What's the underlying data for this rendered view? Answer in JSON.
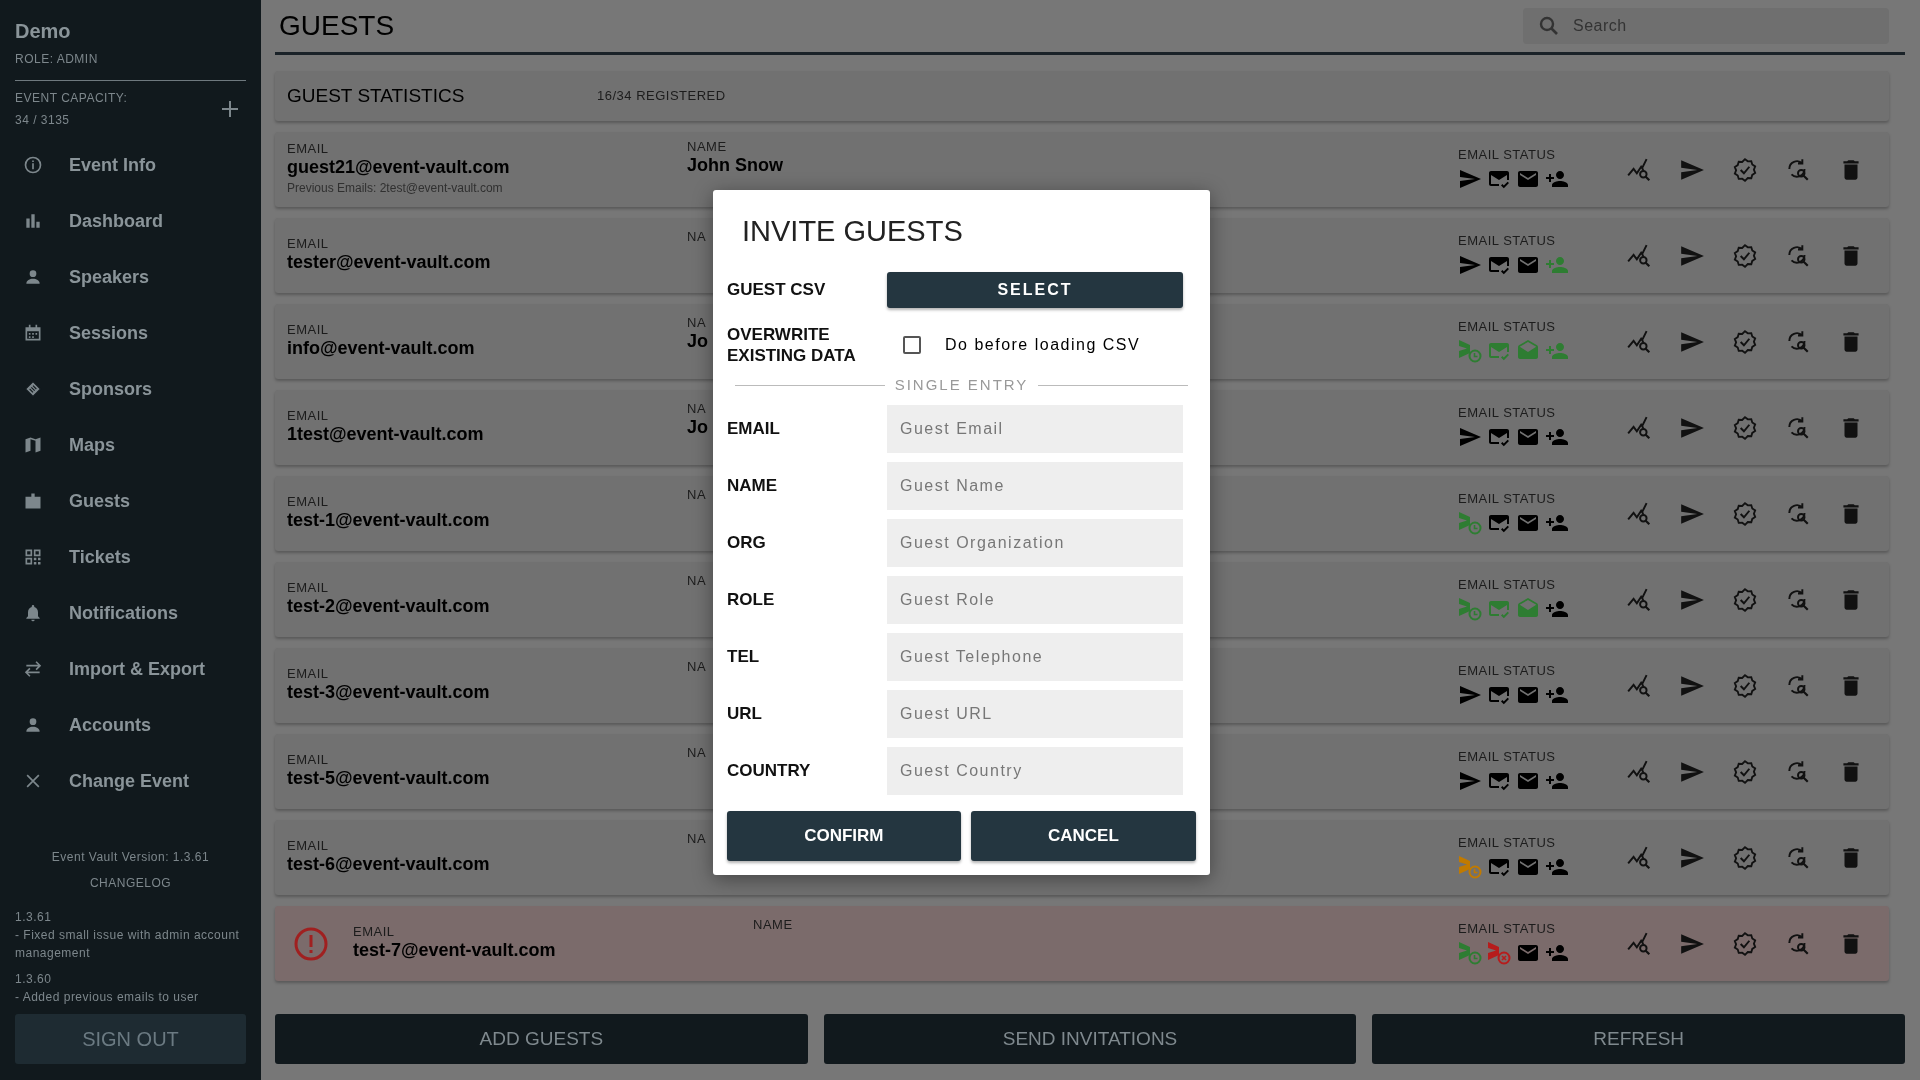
{
  "sidebar": {
    "title": "Demo",
    "role": "ROLE: ADMIN",
    "capacity_label": "EVENT CAPACITY:",
    "capacity": "34 / 3135",
    "items": [
      {
        "label": "Event Info"
      },
      {
        "label": "Dashboard"
      },
      {
        "label": "Speakers"
      },
      {
        "label": "Sessions"
      },
      {
        "label": "Sponsors"
      },
      {
        "label": "Maps"
      },
      {
        "label": "Guests"
      },
      {
        "label": "Tickets"
      },
      {
        "label": "Notifications"
      },
      {
        "label": "Import & Export"
      },
      {
        "label": "Accounts"
      },
      {
        "label": "Change Event"
      }
    ],
    "version": "Event Vault Version: 1.3.61",
    "changelog_link": "CHANGELOG",
    "changelog": [
      {
        "version": "1.3.61",
        "note": "- Fixed small issue with admin account management"
      },
      {
        "version": "1.3.60",
        "note": "- Added previous emails to user"
      }
    ],
    "sign_out": "SIGN OUT"
  },
  "header": {
    "title": "GUESTS",
    "search": {
      "placeholder": "Search"
    }
  },
  "statistics": {
    "title": "GUEST STATISTICS",
    "registered": "16/34 REGISTERED"
  },
  "guests": [
    {
      "email_label": "EMAIL",
      "email": "guest21@event-vault.com",
      "previous": "Previous Emails: 2test@event-vault.com",
      "name_label": "NAME",
      "name": "John Snow",
      "status_label": "EMAIL STATUS",
      "error": false,
      "status": [
        {
          "kind": "sent",
          "color": "#000000"
        },
        {
          "kind": "delivered",
          "color": "#000000"
        },
        {
          "kind": "mail",
          "color": "#000000"
        },
        {
          "kind": "registered",
          "color": "#000000"
        }
      ]
    },
    {
      "email_label": "EMAIL",
      "email": "tester@event-vault.com",
      "name_label": "NA",
      "status_label": "EMAIL STATUS",
      "error": false,
      "status": [
        {
          "kind": "sent",
          "color": "#000000"
        },
        {
          "kind": "delivered",
          "color": "#000000"
        },
        {
          "kind": "mail",
          "color": "#000000"
        },
        {
          "kind": "registered",
          "color": "#2e7d32"
        }
      ]
    },
    {
      "email_label": "EMAIL",
      "email": "info@event-vault.com",
      "name_label": "NA",
      "name": "Jo",
      "status_label": "EMAIL STATUS",
      "error": false,
      "status": [
        {
          "kind": "scheduled",
          "color": "#2e7d32"
        },
        {
          "kind": "delivered",
          "color": "#2e7d32"
        },
        {
          "kind": "opened",
          "color": "#2e7d32"
        },
        {
          "kind": "registered",
          "color": "#2e7d32"
        }
      ]
    },
    {
      "email_label": "EMAIL",
      "email": "1test@event-vault.com",
      "name_label": "NA",
      "name": "Jo",
      "status_label": "EMAIL STATUS",
      "error": false,
      "status": [
        {
          "kind": "sent",
          "color": "#000000"
        },
        {
          "kind": "delivered",
          "color": "#000000"
        },
        {
          "kind": "mail",
          "color": "#000000"
        },
        {
          "kind": "registered",
          "color": "#000000"
        }
      ]
    },
    {
      "email_label": "EMAIL",
      "email": "test-1@event-vault.com",
      "name_label": "NA",
      "status_label": "EMAIL STATUS",
      "error": false,
      "status": [
        {
          "kind": "scheduled",
          "color": "#2e7d32"
        },
        {
          "kind": "delivered",
          "color": "#000000"
        },
        {
          "kind": "mail",
          "color": "#000000"
        },
        {
          "kind": "registered",
          "color": "#000000"
        }
      ]
    },
    {
      "email_label": "EMAIL",
      "email": "test-2@event-vault.com",
      "name_label": "NA",
      "status_label": "EMAIL STATUS",
      "error": false,
      "status": [
        {
          "kind": "scheduled",
          "color": "#2e7d32"
        },
        {
          "kind": "delivered",
          "color": "#2e7d32"
        },
        {
          "kind": "opened",
          "color": "#2e7d32"
        },
        {
          "kind": "registered",
          "color": "#000000"
        }
      ]
    },
    {
      "email_label": "EMAIL",
      "email": "test-3@event-vault.com",
      "name_label": "NA",
      "status_label": "EMAIL STATUS",
      "error": false,
      "status": [
        {
          "kind": "sent",
          "color": "#000000"
        },
        {
          "kind": "delivered",
          "color": "#000000"
        },
        {
          "kind": "mail",
          "color": "#000000"
        },
        {
          "kind": "registered",
          "color": "#000000"
        }
      ]
    },
    {
      "email_label": "EMAIL",
      "email": "test-5@event-vault.com",
      "name_label": "NA",
      "status_label": "EMAIL STATUS",
      "error": false,
      "status": [
        {
          "kind": "sent",
          "color": "#000000"
        },
        {
          "kind": "delivered",
          "color": "#000000"
        },
        {
          "kind": "mail",
          "color": "#000000"
        },
        {
          "kind": "registered",
          "color": "#000000"
        }
      ]
    },
    {
      "email_label": "EMAIL",
      "email": "test-6@event-vault.com",
      "name_label": "NA",
      "status_label": "EMAIL STATUS",
      "error": false,
      "status": [
        {
          "kind": "scheduled",
          "color": "#c17a00"
        },
        {
          "kind": "delivered",
          "color": "#000000"
        },
        {
          "kind": "mail",
          "color": "#000000"
        },
        {
          "kind": "registered",
          "color": "#000000"
        }
      ]
    },
    {
      "email_label": "EMAIL",
      "email": "test-7@event-vault.com",
      "name_label": "NAME",
      "status_label": "EMAIL STATUS",
      "error": true,
      "status": [
        {
          "kind": "scheduled",
          "color": "#2e7d32"
        },
        {
          "kind": "failed",
          "color": "#b71c1c"
        },
        {
          "kind": "mail",
          "color": "#000000"
        },
        {
          "kind": "registered",
          "color": "#000000"
        }
      ]
    }
  ],
  "modal": {
    "title": "INVITE GUESTS",
    "csv_label": "GUEST CSV",
    "select": "SELECT",
    "overwrite_label": "OVERWRITE EXISTING DATA",
    "overwrite": {
      "checked": false,
      "label": "Do before loading CSV"
    },
    "divider": "SINGLE ENTRY",
    "fields": [
      {
        "label": "EMAIL",
        "placeholder": "Guest Email"
      },
      {
        "label": "NAME",
        "placeholder": "Guest Name"
      },
      {
        "label": "ORG",
        "placeholder": "Guest Organization"
      },
      {
        "label": "ROLE",
        "placeholder": "Guest Role"
      },
      {
        "label": "TEL",
        "placeholder": "Guest Telephone"
      },
      {
        "label": "URL",
        "placeholder": "Guest URL"
      },
      {
        "label": "COUNTRY",
        "placeholder": "Guest Country"
      }
    ],
    "buttons": [
      "CONFIRM",
      "CANCEL"
    ]
  },
  "footer_buttons": [
    "ADD GUESTS",
    "SEND INVITATIONS",
    "REFRESH"
  ]
}
